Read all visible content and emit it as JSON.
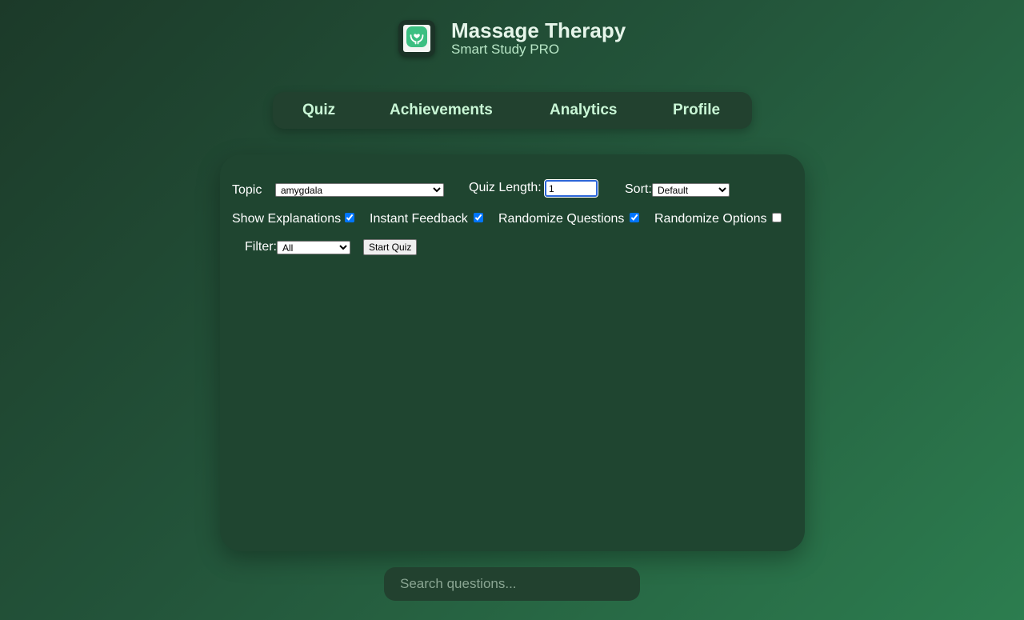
{
  "header": {
    "title": "Massage Therapy",
    "subtitle": "Smart Study PRO",
    "logo_icon": "hands-heart-icon"
  },
  "nav": {
    "tabs": [
      {
        "label": "Quiz"
      },
      {
        "label": "Achievements"
      },
      {
        "label": "Analytics"
      },
      {
        "label": "Profile"
      }
    ]
  },
  "controls": {
    "topic_label": "Topic",
    "topic_value": "amygdala",
    "quiz_length_label": "Quiz Length:",
    "quiz_length_value": "1",
    "sort_label": "Sort:",
    "sort_value": "Default",
    "show_explanations_label": "Show Explanations",
    "show_explanations_checked": true,
    "instant_feedback_label": "Instant Feedback",
    "instant_feedback_checked": true,
    "randomize_questions_label": "Randomize Questions",
    "randomize_questions_checked": true,
    "randomize_options_label": "Randomize Options",
    "randomize_options_checked": false,
    "filter_label": "Filter:",
    "filter_value": "All",
    "start_button_label": "Start Quiz"
  },
  "search": {
    "placeholder": "Search questions..."
  },
  "colors": {
    "background_start": "#1c3a29",
    "background_end": "#2c7d4f",
    "panel": "#1f4530",
    "nav_text": "#c9f7d6",
    "accent_checkbox": "#1a73e8"
  }
}
